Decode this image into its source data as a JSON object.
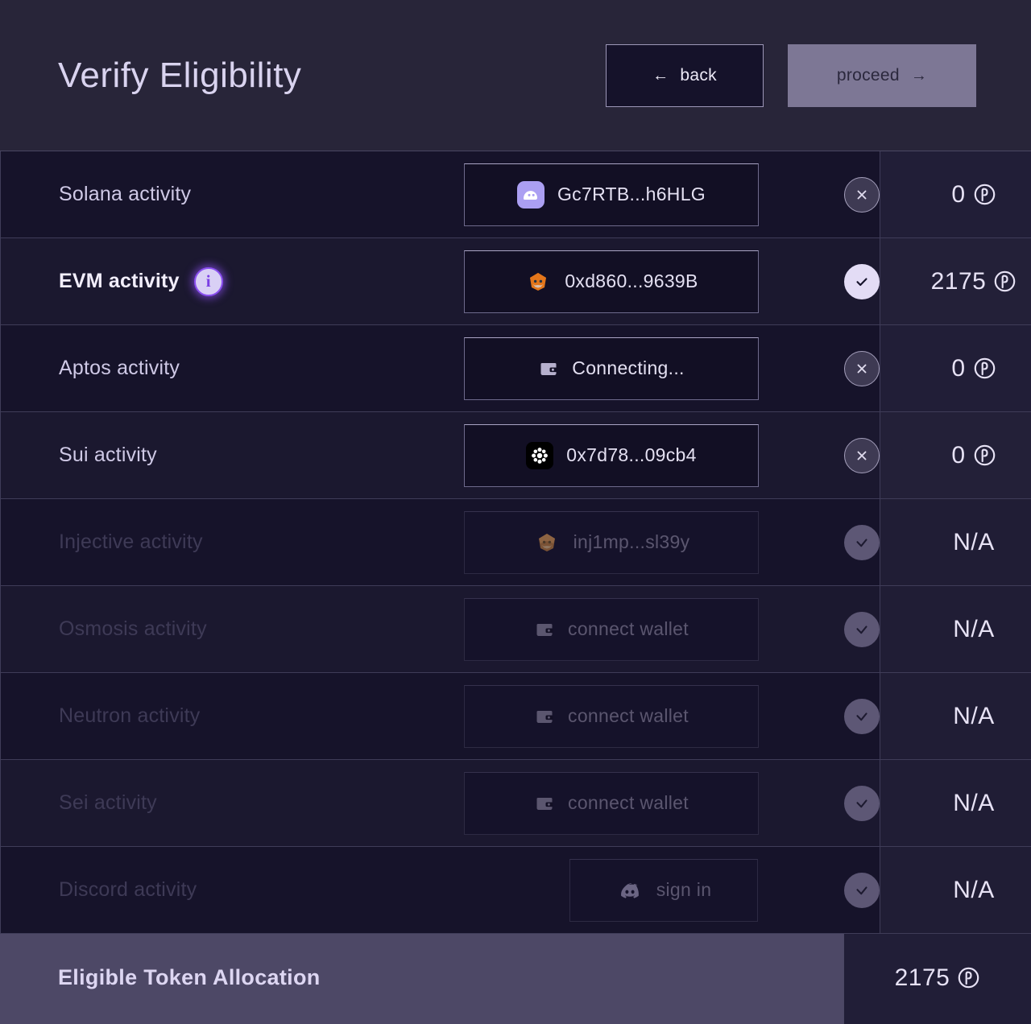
{
  "header": {
    "title": "Verify Eligibility",
    "back_label": "back",
    "back_arrow": "←",
    "proceed_label": "proceed",
    "proceed_arrow": "→"
  },
  "colors": {
    "page_bg": "#282539",
    "row_bg": "#16132a",
    "accent_lavender": "#d9d3ef",
    "proceed_bg": "#7d7795",
    "info_purple": "#8a4ff0",
    "total_bg": "#4d4866"
  },
  "rows": [
    {
      "label": "Solana activity",
      "wallet_text": "Gc7RTB...h6HLG",
      "wallet_icon": "phantom-icon",
      "action": "x",
      "amount": "0",
      "token": "℗",
      "state": "connected",
      "has_info": false
    },
    {
      "label": "EVM activity",
      "wallet_text": "0xd860...9639B",
      "wallet_icon": "metamask-icon",
      "action": "check-on",
      "amount": "2175",
      "token": "℗",
      "state": "verified",
      "has_info": true
    },
    {
      "label": "Aptos activity",
      "wallet_text": "Connecting...",
      "wallet_icon": "wallet-icon",
      "action": "x",
      "amount": "0",
      "token": "℗",
      "state": "connecting",
      "has_info": false
    },
    {
      "label": "Sui activity",
      "wallet_text": "0x7d78...09cb4",
      "wallet_icon": "backpack-icon",
      "action": "x",
      "amount": "0",
      "token": "℗",
      "state": "connected",
      "has_info": false
    },
    {
      "label": "Injective activity",
      "wallet_text": "inj1mp...sl39y",
      "wallet_icon": "metamask-icon",
      "action": "check-off",
      "amount": "N/A",
      "token": "",
      "state": "disabled",
      "has_info": false
    },
    {
      "label": "Osmosis activity",
      "wallet_text": "connect wallet",
      "wallet_icon": "wallet-icon",
      "action": "check-off",
      "amount": "N/A",
      "token": "",
      "state": "disabled",
      "has_info": false
    },
    {
      "label": "Neutron activity",
      "wallet_text": "connect wallet",
      "wallet_icon": "wallet-icon",
      "action": "check-off",
      "amount": "N/A",
      "token": "",
      "state": "disabled",
      "has_info": false
    },
    {
      "label": "Sei activity",
      "wallet_text": "connect wallet",
      "wallet_icon": "wallet-icon",
      "action": "check-off",
      "amount": "N/A",
      "token": "",
      "state": "disabled",
      "has_info": false
    },
    {
      "label": "Discord activity",
      "wallet_text": "sign in",
      "wallet_icon": "discord-icon",
      "action": "check-off",
      "amount": "N/A",
      "token": "",
      "state": "disabled",
      "has_info": false
    }
  ],
  "total": {
    "label": "Eligible Token Allocation",
    "amount": "2175",
    "token": "℗"
  }
}
